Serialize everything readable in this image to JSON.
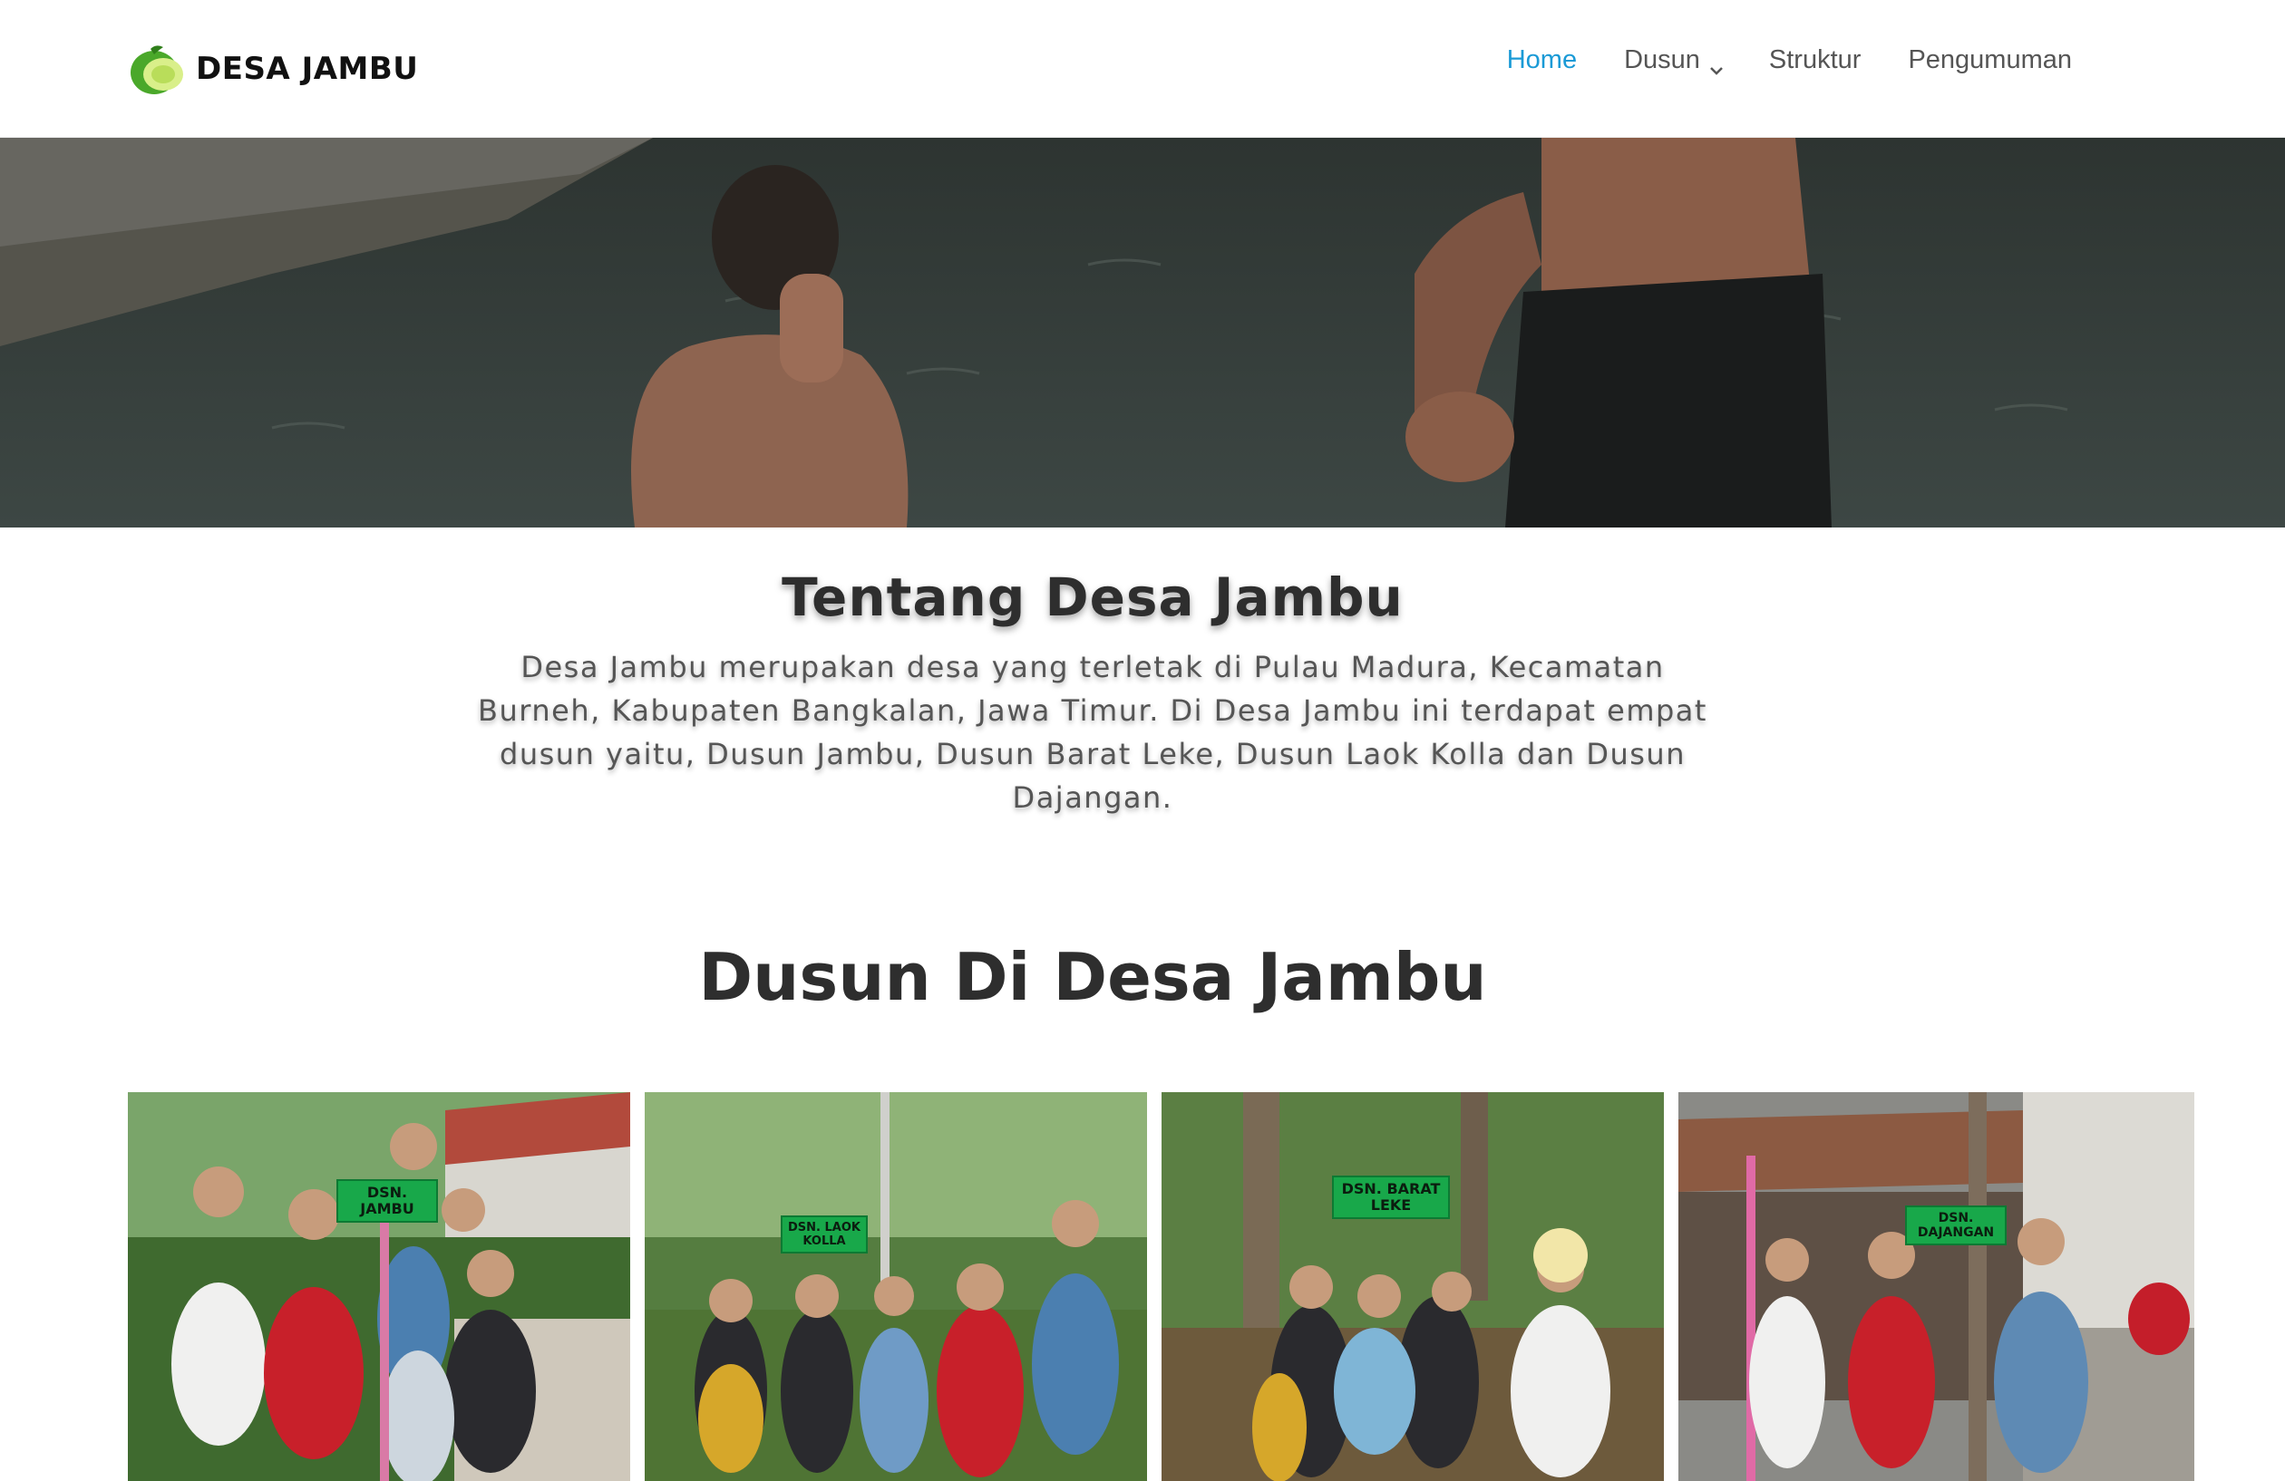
{
  "header": {
    "logo_text": "DESA JAMBU",
    "nav": [
      {
        "label": "Home",
        "active": true
      },
      {
        "label": "Dusun",
        "active": false,
        "has_dropdown": true
      },
      {
        "label": "Struktur",
        "active": false
      },
      {
        "label": "Pengumuman",
        "active": false
      }
    ]
  },
  "about": {
    "title": "Tentang Desa Jambu",
    "text": "Desa Jambu merupakan desa yang terletak di Pulau Madura, Kecamatan Burneh, Kabupaten Bangkalan, Jawa Timur. Di Desa Jambu ini terdapat empat dusun yaitu, Dusun Jambu, Dusun Barat Leke, Dusun Laok Kolla dan Dusun Dajangan."
  },
  "dusun_section": {
    "title": "Dusun Di Desa Jambu",
    "cards": [
      {
        "sign": "DSN. JAMBU"
      },
      {
        "sign": "DSN. LAOK KOLLA"
      },
      {
        "sign": "DSN. BARAT LEKE"
      },
      {
        "sign": "DSN. DAJANGAN"
      }
    ]
  },
  "colors": {
    "accent": "#1a9ad6",
    "nav_text": "#555555",
    "logo_green": "#6cbf2a",
    "sign_green": "#18a84a"
  },
  "icons": {
    "logo": "guava-icon",
    "dropdown": "chevron-down-icon"
  }
}
